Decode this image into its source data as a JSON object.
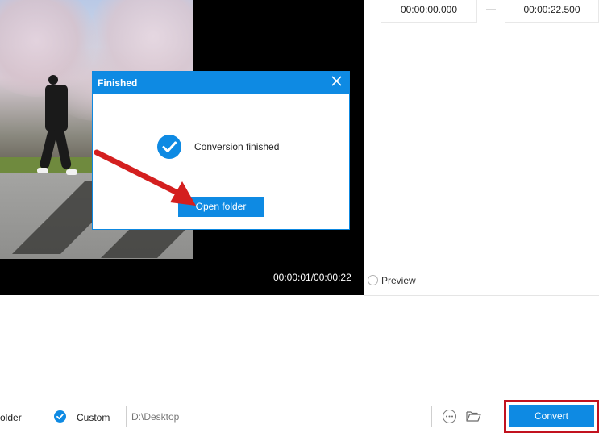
{
  "video": {
    "timecode": "00:00:01/00:00:22"
  },
  "trim": {
    "start_time": "00:00:00.000",
    "end_time": "00:00:22.500"
  },
  "preview": {
    "label": "Preview"
  },
  "dialog": {
    "title": "Finished",
    "close_icon": "close-icon",
    "message": "Conversion finished",
    "status_icon": "check-circle-icon",
    "open_folder_label": "Open folder"
  },
  "output": {
    "folder_label_partial": "older",
    "custom_label": "Custom",
    "path_value": "D:\\Desktop",
    "more_icon": "more-options-icon",
    "browse_icon": "folder-icon"
  },
  "actions": {
    "convert_label": "Convert"
  },
  "colors": {
    "accent": "#0e8ae3",
    "highlight_border": "#c2121f",
    "arrow": "#d41f1f"
  }
}
